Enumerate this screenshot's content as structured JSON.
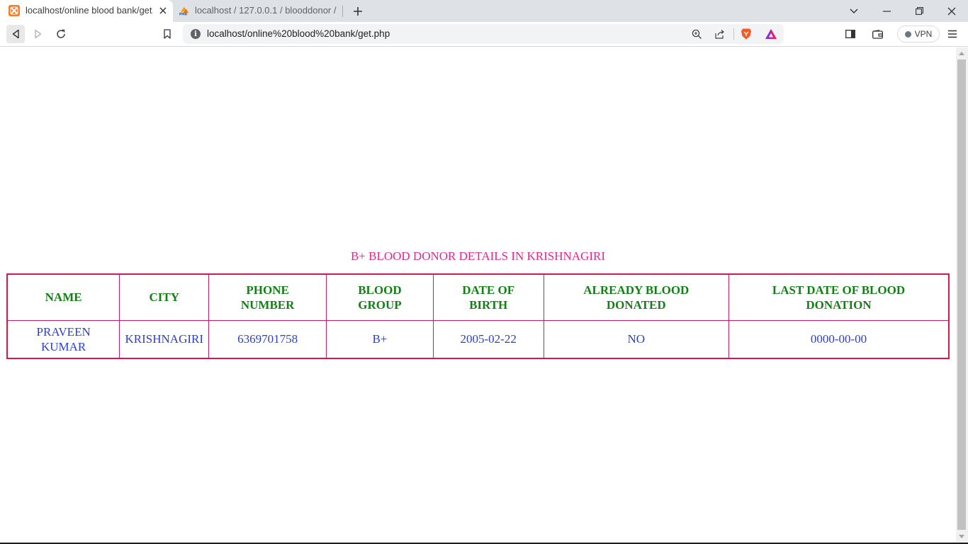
{
  "browser": {
    "tabs": [
      {
        "title": "localhost/online blood bank/get.",
        "favicon": "xampp-icon",
        "active": true
      },
      {
        "title": "localhost / 127.0.0.1 / blooddonor / bl",
        "favicon": "phpmyadmin-icon",
        "active": false
      }
    ],
    "address_bar": {
      "url": "localhost/online%20blood%20bank/get.php"
    },
    "vpn_label": "VPN"
  },
  "page": {
    "heading": "B+ BLOOD DONOR DETAILS IN KRISHNAGIRI",
    "table": {
      "headers": [
        [
          "NAME"
        ],
        [
          "CITY"
        ],
        [
          "PHONE",
          "NUMBER"
        ],
        [
          "BLOOD",
          "GROUP"
        ],
        [
          "DATE OF",
          "BIRTH"
        ],
        [
          "ALREADY BLOOD",
          "DONATED"
        ],
        [
          "LAST DATE OF BLOOD",
          "DONATION"
        ]
      ],
      "rows": [
        {
          "name": [
            "PRAVEEN",
            "KUMAR"
          ],
          "city": "KRISHNAGIRI",
          "phone": "6369701758",
          "blood_group": "B+",
          "dob": "2005-02-22",
          "already_donated": "NO",
          "last_donation": "0000-00-00"
        }
      ]
    }
  },
  "colors": {
    "heading": "#e3268c",
    "header_text": "#138016",
    "cell_text": "#2a3fd0",
    "table_border": "#d4184a"
  }
}
